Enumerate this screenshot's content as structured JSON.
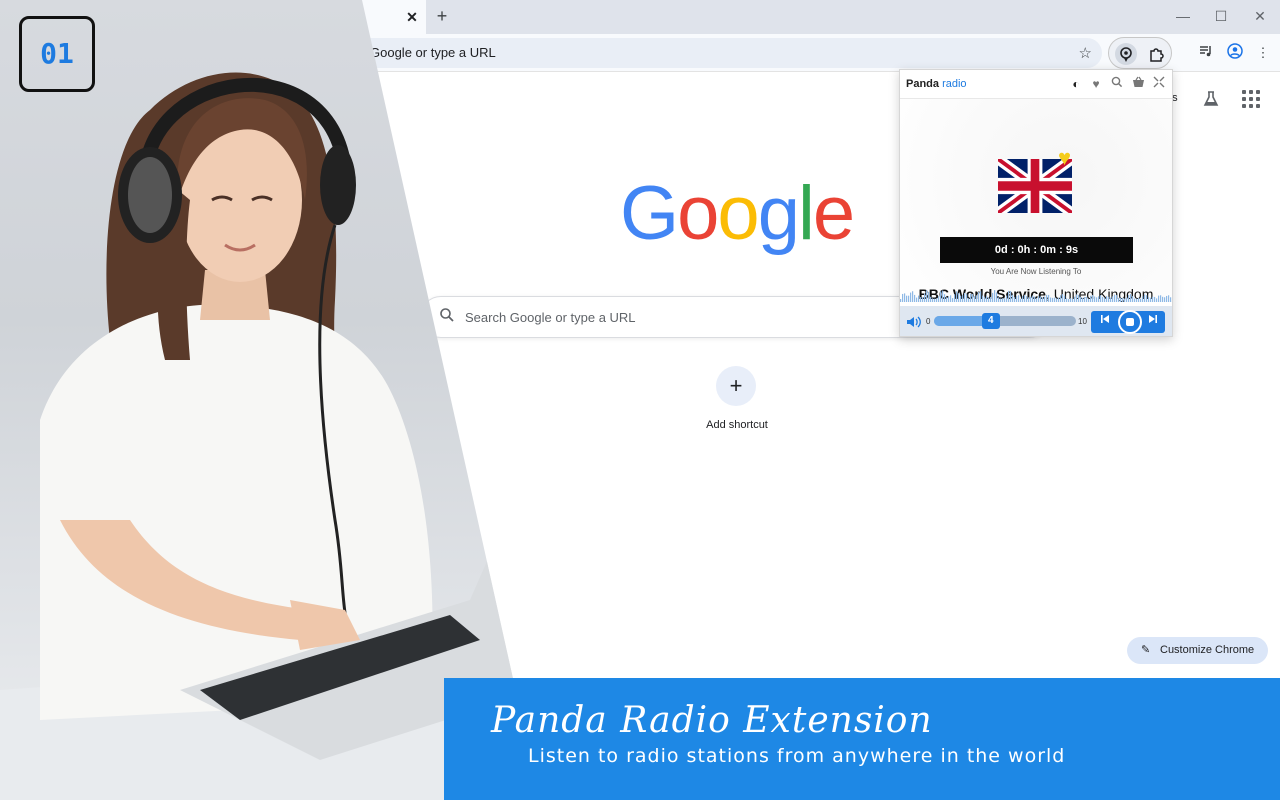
{
  "browser": {
    "omnibox_text": "Google or type a URL",
    "window_controls": {
      "minimize": "—",
      "maximize": "☐",
      "close": "✕"
    },
    "tab_close": "✕",
    "new_tab": "+"
  },
  "ntp": {
    "logo": [
      "G",
      "o",
      "o",
      "g",
      "l",
      "e"
    ],
    "logo_colors": [
      "#4285F4",
      "#EA4335",
      "#FBBC05",
      "#4285F4",
      "#34A853",
      "#EA4335"
    ],
    "search_placeholder": "Search Google or type a URL",
    "add_shortcut_symbol": "+",
    "add_shortcut_label": "Add shortcut",
    "images_link": "es",
    "customize_label": "Customize Chrome"
  },
  "popup": {
    "brand_bold": "Panda",
    "brand_accent": "radio",
    "timer": "0d : 0h : 0m : 9s",
    "listening_label": "You Are Now Listening To",
    "station_name": "BBC World Service",
    "station_country": ", United Kingdom",
    "volume_min": "0",
    "volume_max": "10",
    "volume_value": "4",
    "volume_fraction": 0.4,
    "accent_color": "#1e7be0"
  },
  "badge": {
    "number": "01"
  },
  "banner": {
    "title": "Panda Radio Extension",
    "subtitle": "Listen to radio stations from anywhere in the world",
    "color": "#1e88e5"
  }
}
